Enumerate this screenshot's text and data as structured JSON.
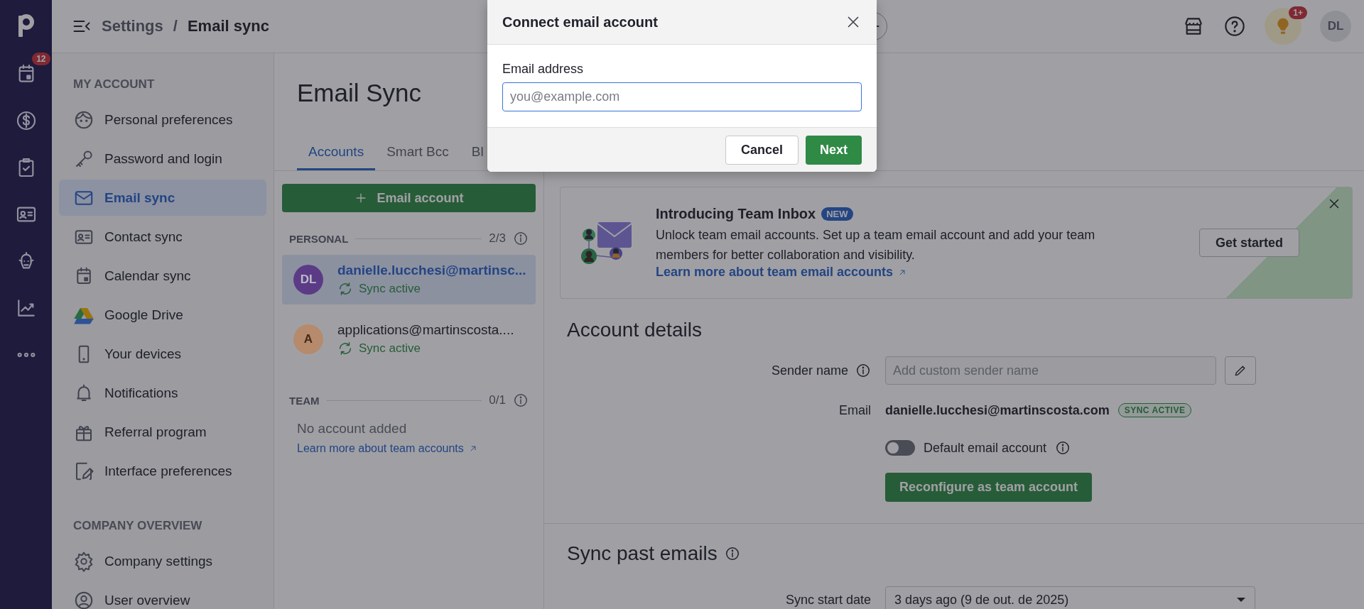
{
  "nav_rail": {
    "badge": "12"
  },
  "header": {
    "breadcrumb_parent": "Settings",
    "separator": "/",
    "breadcrumb_current": "Email sync",
    "notification_badge": "1+",
    "avatar": "DL"
  },
  "settings_nav": [
    {
      "title": "MY ACCOUNT",
      "items": [
        {
          "label": "Personal preferences",
          "selected": false
        },
        {
          "label": "Password and login",
          "selected": false
        },
        {
          "label": "Email sync",
          "selected": true
        },
        {
          "label": "Contact sync",
          "selected": false
        },
        {
          "label": "Calendar sync",
          "selected": false
        },
        {
          "label": "Google Drive",
          "selected": false
        },
        {
          "label": "Your devices",
          "selected": false
        },
        {
          "label": "Notifications",
          "selected": false
        },
        {
          "label": "Referral program",
          "selected": false
        },
        {
          "label": "Interface preferences",
          "selected": false
        }
      ]
    },
    {
      "title": "COMPANY OVERVIEW",
      "items": [
        {
          "label": "Company settings",
          "selected": false
        },
        {
          "label": "User overview",
          "selected": false
        }
      ]
    }
  ],
  "page": {
    "title": "Email Sync",
    "tabs": [
      {
        "label": "Accounts",
        "selected": true
      },
      {
        "label": "Smart Bcc",
        "selected": false
      },
      {
        "label": "Bl",
        "selected": false
      }
    ]
  },
  "accounts": {
    "add_button": "Email account",
    "groups": [
      {
        "title": "PERSONAL",
        "count": "2/3",
        "items": [
          {
            "avatar": "DL",
            "color": "#5b3b86",
            "email": "danielle.lucchesi@martinsc...",
            "status": "Sync active",
            "selected": true
          },
          {
            "avatar": "A",
            "color": "#b58a6d",
            "email": "applications@martinscosta....",
            "status": "Sync active",
            "selected": false
          }
        ]
      },
      {
        "title": "TEAM",
        "count": "0/1",
        "empty": "No account added",
        "link": "Learn more about team accounts"
      }
    ]
  },
  "banner": {
    "title": "Introducing Team Inbox",
    "badge": "NEW",
    "text": "Unlock team email accounts. Set up a team email account and add your team members for better collaboration and visibility.",
    "link": "Learn more about team email accounts",
    "button": "Get started"
  },
  "account_details": {
    "heading": "Account details",
    "sender_label": "Sender name",
    "sender_placeholder": "Add custom sender name",
    "email_label": "Email",
    "email": "danielle.lucchesi@martinscosta.com",
    "status_badge": "SYNC ACTIVE",
    "default_toggle": {
      "label": "Default email account",
      "on": false
    },
    "button": "Reconfigure as team account"
  },
  "sync_past": {
    "heading": "Sync past emails",
    "label": "Sync start date",
    "value": "3 days ago (9 de out. de 2025)"
  },
  "modal": {
    "title": "Connect email account",
    "field_label": "Email address",
    "placeholder": "you@example.com",
    "cancel": "Cancel",
    "next": "Next"
  }
}
